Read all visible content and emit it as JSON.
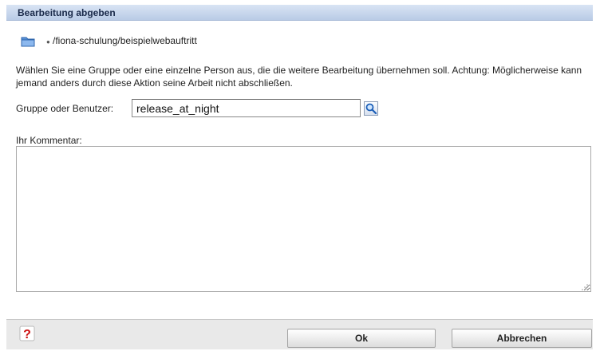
{
  "dialog": {
    "title": "Bearbeitung abgeben",
    "path": "/fiona-schulung/beispielwebauftritt",
    "description": "Wählen Sie eine Gruppe oder eine einzelne Person aus, die die weitere Bearbeitung übernehmen soll. Achtung: Möglicherweise kann jemand anders durch diese Aktion seine Arbeit nicht abschließen.",
    "user_field": {
      "label": "Gruppe oder Benutzer:",
      "value": "release_at_night"
    },
    "comment": {
      "label": "Ihr Kommentar:",
      "value": ""
    }
  },
  "footer": {
    "ok_label": "Ok",
    "cancel_label": "Abbrechen",
    "help_icon": "help-icon"
  },
  "icons": {
    "folder": "folder-icon",
    "search": "search-icon",
    "bullet": "bullet-icon"
  },
  "colors": {
    "titlebar": "#c5d4ec",
    "footer": "#e9e9e9",
    "help_red": "#cc1111",
    "folder_blue": "#5a93d8"
  }
}
